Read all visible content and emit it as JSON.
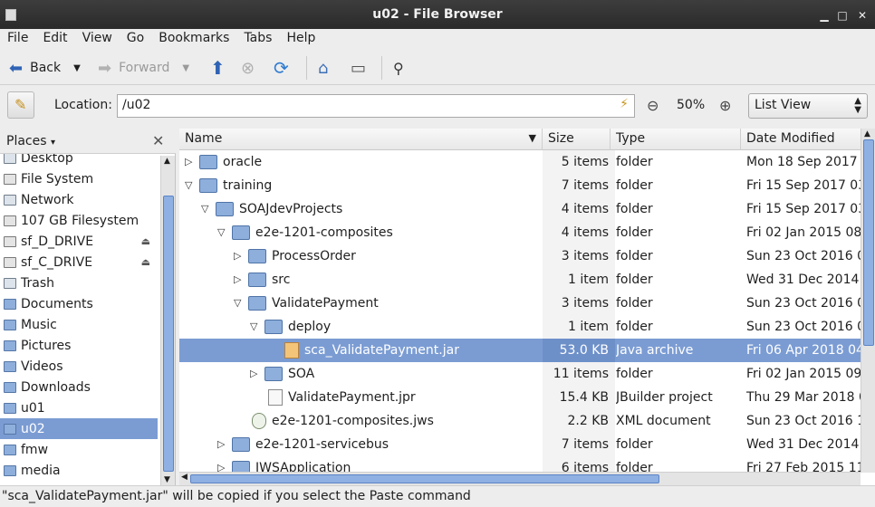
{
  "window": {
    "title": "u02 - File Browser"
  },
  "menu": [
    "File",
    "Edit",
    "View",
    "Go",
    "Bookmarks",
    "Tabs",
    "Help"
  ],
  "toolbar": {
    "back_label": "Back",
    "forward_label": "Forward"
  },
  "location": {
    "label": "Location:",
    "value": "/u02",
    "zoom": "50%",
    "view_mode": "List View"
  },
  "sidebar": {
    "header": "Places",
    "items": [
      {
        "label": "Desktop",
        "icon": "desktop-icon"
      },
      {
        "label": "File System",
        "icon": "drive-icon"
      },
      {
        "label": "Network",
        "icon": "network-icon"
      },
      {
        "label": "107 GB Filesystem",
        "icon": "drive-icon"
      },
      {
        "label": "sf_D_DRIVE",
        "icon": "drive-icon",
        "eject": true
      },
      {
        "label": "sf_C_DRIVE",
        "icon": "drive-icon",
        "eject": true
      },
      {
        "label": "Trash",
        "icon": "trash-icon"
      },
      {
        "label": "Documents",
        "icon": "folder-icon"
      },
      {
        "label": "Music",
        "icon": "folder-icon"
      },
      {
        "label": "Pictures",
        "icon": "folder-icon"
      },
      {
        "label": "Videos",
        "icon": "folder-icon"
      },
      {
        "label": "Downloads",
        "icon": "folder-icon"
      },
      {
        "label": "u01",
        "icon": "folder-icon"
      },
      {
        "label": "u02",
        "icon": "folder-icon",
        "selected": true
      },
      {
        "label": "fmw",
        "icon": "folder-icon"
      },
      {
        "label": "media",
        "icon": "folder-icon"
      }
    ]
  },
  "columns": [
    "Name",
    "Size",
    "Type",
    "Date Modified"
  ],
  "rows": [
    {
      "name": "oracle",
      "size": "5 items",
      "type": "folder",
      "date": "Mon 18 Sep 2017",
      "level": 0,
      "expander": "collapsed",
      "icon": "folder"
    },
    {
      "name": "training",
      "size": "7 items",
      "type": "folder",
      "date": "Fri 15 Sep 2017 03",
      "level": 0,
      "expander": "expanded",
      "icon": "folder"
    },
    {
      "name": "SOAJdevProjects",
      "size": "4 items",
      "type": "folder",
      "date": "Fri 15 Sep 2017 03",
      "level": 1,
      "expander": "expanded",
      "icon": "folder"
    },
    {
      "name": "e2e-1201-composites",
      "size": "4 items",
      "type": "folder",
      "date": "Fri 02 Jan 2015 08",
      "level": 2,
      "expander": "expanded",
      "icon": "folder"
    },
    {
      "name": "ProcessOrder",
      "size": "3 items",
      "type": "folder",
      "date": "Sun 23 Oct 2016 0",
      "level": 3,
      "expander": "collapsed",
      "icon": "folder"
    },
    {
      "name": "src",
      "size": "1 item",
      "type": "folder",
      "date": "Wed 31 Dec 2014 0",
      "level": 3,
      "expander": "collapsed",
      "icon": "folder"
    },
    {
      "name": "ValidatePayment",
      "size": "3 items",
      "type": "folder",
      "date": "Sun 23 Oct 2016 0",
      "level": 3,
      "expander": "expanded",
      "icon": "folder"
    },
    {
      "name": "deploy",
      "size": "1 item",
      "type": "folder",
      "date": "Sun 23 Oct 2016 0",
      "level": 4,
      "expander": "expanded",
      "icon": "folder"
    },
    {
      "name": "sca_ValidatePayment.jar",
      "size": "53.0 KB",
      "type": "Java archive",
      "date": "Fri 06 Apr 2018 04",
      "level": 5,
      "expander": "none",
      "icon": "jar",
      "selected": true
    },
    {
      "name": "SOA",
      "size": "11 items",
      "type": "folder",
      "date": "Fri 02 Jan 2015 09",
      "level": 4,
      "expander": "collapsed",
      "icon": "folder"
    },
    {
      "name": "ValidatePayment.jpr",
      "size": "15.4 KB",
      "type": "JBuilder project",
      "date": "Thu 29 Mar 2018 0",
      "level": 4,
      "expander": "none",
      "icon": "doc"
    },
    {
      "name": "e2e-1201-composites.jws",
      "size": "2.2 KB",
      "type": "XML document",
      "date": "Sun 23 Oct 2016 1",
      "level": 3,
      "expander": "none",
      "icon": "xml"
    },
    {
      "name": "e2e-1201-servicebus",
      "size": "7 items",
      "type": "folder",
      "date": "Wed 31 Dec 2014 0",
      "level": 2,
      "expander": "collapsed",
      "icon": "folder"
    },
    {
      "name": "IWSApplication",
      "size": "6 items",
      "type": "folder",
      "date": "Fri 27 Feb 2015 11",
      "level": 2,
      "expander": "collapsed",
      "icon": "folder"
    }
  ],
  "status": "\"sca_ValidatePayment.jar\" will be copied if you select the Paste command"
}
